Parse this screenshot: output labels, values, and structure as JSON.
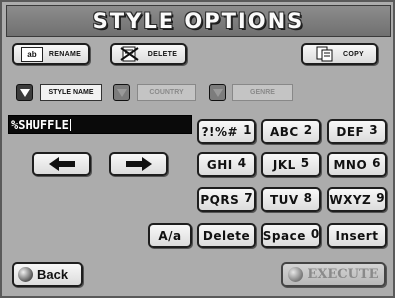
{
  "title": "STYLE OPTIONS",
  "toolbar": {
    "rename_label": "RENAME",
    "rename_icon_text": "ab",
    "delete_label": "DELETE",
    "copy_label": "COPY"
  },
  "filters": {
    "style_name": {
      "label": "STYLE NAME",
      "checked": true
    },
    "country": {
      "label": "COUNTRY",
      "checked": false
    },
    "genre": {
      "label": "GENRE",
      "checked": false
    }
  },
  "name_field": {
    "value": "%SHUFFLE"
  },
  "keypad": {
    "row1": [
      {
        "label": "?!%#",
        "num": "1"
      },
      {
        "label": "ABC",
        "num": "2"
      },
      {
        "label": "DEF",
        "num": "3"
      }
    ],
    "row2": [
      {
        "label": "GHI",
        "num": "4"
      },
      {
        "label": "JKL",
        "num": "5"
      },
      {
        "label": "MNO",
        "num": "6"
      }
    ],
    "row3": [
      {
        "label": "PQRS",
        "num": "7"
      },
      {
        "label": "TUV",
        "num": "8"
      },
      {
        "label": "WXYZ",
        "num": "9"
      }
    ],
    "case_label": "A/a",
    "delete_label": "Delete",
    "space_label": "Space",
    "space_num": "0",
    "insert_label": "Insert"
  },
  "nav": {
    "back_label": "Back",
    "execute_label": "EXECUTE"
  },
  "colors": {
    "screen_bg": "#acacac",
    "title_bg": "#7a7a7a",
    "input_bg": "#0a0a0a",
    "execute_disabled": "#8a8a8a"
  }
}
